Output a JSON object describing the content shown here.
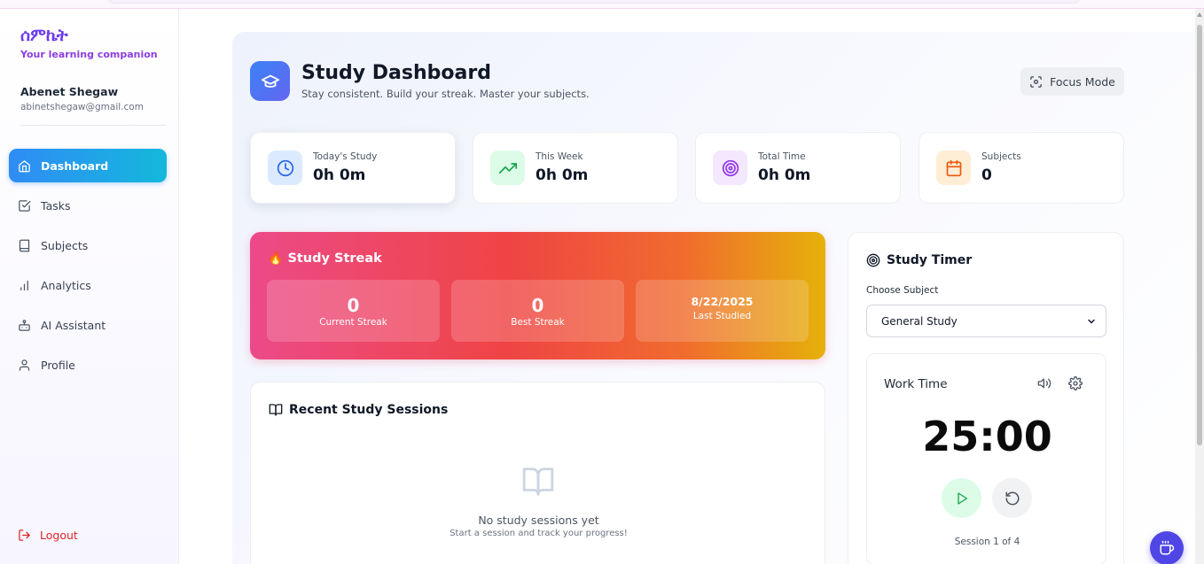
{
  "brand": {
    "name": "ሰምኬት",
    "tagline": "Your learning companion"
  },
  "user": {
    "name": "Abenet Shegaw",
    "email": "abinetshegaw@gmail.com"
  },
  "nav": {
    "items": [
      {
        "label": "Dashboard",
        "icon": "home-icon",
        "active": true
      },
      {
        "label": "Tasks",
        "icon": "check-square-icon"
      },
      {
        "label": "Subjects",
        "icon": "book-icon"
      },
      {
        "label": "Analytics",
        "icon": "bar-chart-icon"
      },
      {
        "label": "AI Assistant",
        "icon": "bot-icon"
      },
      {
        "label": "Profile",
        "icon": "user-icon"
      }
    ],
    "logout": "Logout"
  },
  "header": {
    "title": "Study Dashboard",
    "subtitle": "Stay consistent. Build your streak. Master your subjects.",
    "focus_label": "Focus Mode"
  },
  "stats": [
    {
      "label": "Today's Study",
      "value": "0h 0m",
      "icon": "clock-icon",
      "color": "#2563eb"
    },
    {
      "label": "This Week",
      "value": "0h 0m",
      "icon": "trending-up-icon",
      "color": "#16a34a"
    },
    {
      "label": "Total Time",
      "value": "0h 0m",
      "icon": "target-icon",
      "color": "#9333ea"
    },
    {
      "label": "Subjects",
      "value": "0",
      "icon": "calendar-icon",
      "color": "#ea580c"
    }
  ],
  "streak": {
    "title": "Study Streak",
    "current_value": "0",
    "current_label": "Current Streak",
    "best_value": "0",
    "best_label": "Best Streak",
    "last_value": "8/22/2025",
    "last_label": "Last Studied"
  },
  "recent": {
    "title": "Recent Study Sessions",
    "empty_title": "No study sessions yet",
    "empty_sub": "Start a session and track your progress!"
  },
  "timer": {
    "title": "Study Timer",
    "choose_label": "Choose Subject",
    "selected_subject": "General Study",
    "mode_label": "Work Time",
    "time": "25:00",
    "session": "Session 1 of 4"
  },
  "colors": {
    "accent": "#2f8cf5",
    "brand": "#6d3df0",
    "logout": "#dc2626",
    "fab": "#4f46e5"
  }
}
